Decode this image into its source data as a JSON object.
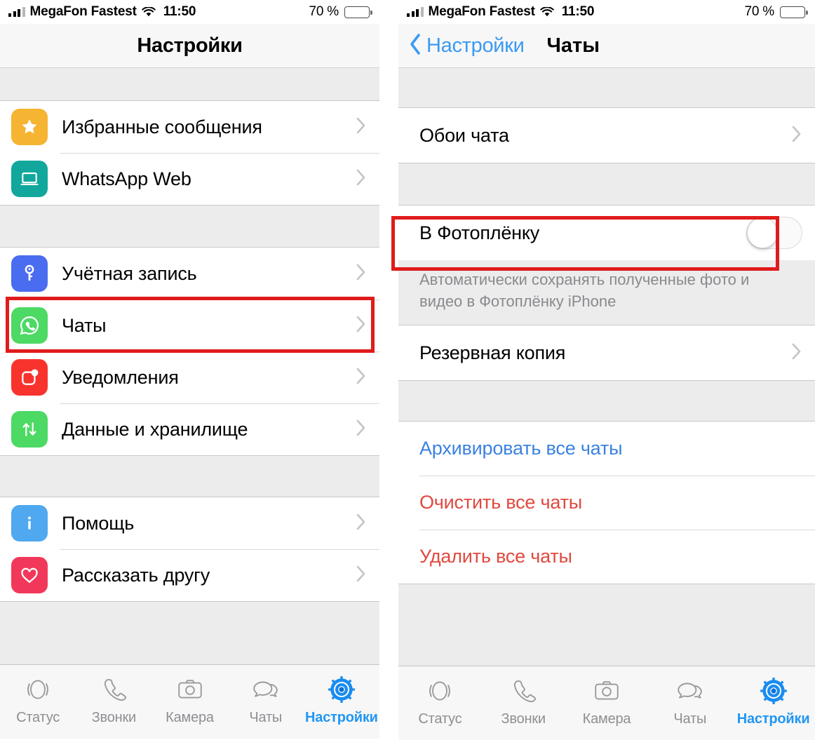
{
  "status_bar": {
    "carrier": "MegaFon Fastest",
    "time": "11:50",
    "battery_percent": "70 %",
    "signal_icon": "cellular-bars-icon",
    "wifi_icon": "wifi-icon",
    "battery_icon": "battery-icon"
  },
  "left_screen": {
    "nav": {
      "title": "Настройки"
    },
    "groups": [
      {
        "rows": [
          {
            "label": "Избранные сообщения",
            "icon": "star-icon",
            "icon_color": "#f5b431",
            "accessory": "chevron-right-icon"
          },
          {
            "label": "WhatsApp Web",
            "icon": "laptop-icon",
            "icon_color": "#11a79c",
            "accessory": "chevron-right-icon"
          }
        ]
      },
      {
        "rows": [
          {
            "label": "Учётная запись",
            "icon": "key-icon",
            "icon_color": "#4a6cf0",
            "accessory": "chevron-right-icon"
          },
          {
            "label": "Чаты",
            "icon": "whatsapp-icon",
            "icon_color": "#4cd964",
            "accessory": "chevron-right-icon",
            "highlighted": true
          },
          {
            "label": "Уведомления",
            "icon": "notification-badge-icon",
            "icon_color": "#f8332e",
            "accessory": "chevron-right-icon"
          },
          {
            "label": "Данные и хранилище",
            "icon": "data-arrows-icon",
            "icon_color": "#4cd964",
            "accessory": "chevron-right-icon"
          }
        ]
      },
      {
        "rows": [
          {
            "label": "Помощь",
            "icon": "info-icon",
            "icon_color": "#4fa8f0",
            "accessory": "chevron-right-icon"
          },
          {
            "label": "Рассказать другу",
            "icon": "heart-icon",
            "icon_color": "#f2385a",
            "accessory": "chevron-right-icon"
          }
        ]
      }
    ]
  },
  "right_screen": {
    "nav": {
      "back_label": "Настройки",
      "title": "Чаты",
      "back_icon": "chevron-left-icon"
    },
    "wallpaper_row": {
      "label": "Обои чата",
      "accessory": "chevron-right-icon"
    },
    "save_to_camera_roll": {
      "label": "В Фотоплёнку",
      "toggle_state": "off",
      "description": "Автоматически сохранять полученные фото и видео в Фотоплёнку iPhone",
      "highlighted": true
    },
    "backup_row": {
      "label": "Резервная копия",
      "accessory": "chevron-right-icon"
    },
    "actions": [
      {
        "label": "Архивировать все чаты",
        "color": "#3b82e0"
      },
      {
        "label": "Очистить все чаты",
        "color": "#e0493f"
      },
      {
        "label": "Удалить все чаты",
        "color": "#e0493f"
      }
    ]
  },
  "tab_bar": {
    "items": [
      {
        "label": "Статус",
        "icon": "status-ring-icon",
        "active": false
      },
      {
        "label": "Звонки",
        "icon": "phone-icon",
        "active": false
      },
      {
        "label": "Камера",
        "icon": "camera-icon",
        "active": false
      },
      {
        "label": "Чаты",
        "icon": "chat-bubbles-icon",
        "active": false
      },
      {
        "label": "Настройки",
        "icon": "gear-icon",
        "active": true
      }
    ]
  },
  "colors": {
    "accent_blue": "#2196f3",
    "highlight_red": "#e01b1b",
    "destructive_red": "#e0493f",
    "link_blue": "#3b82e0"
  }
}
